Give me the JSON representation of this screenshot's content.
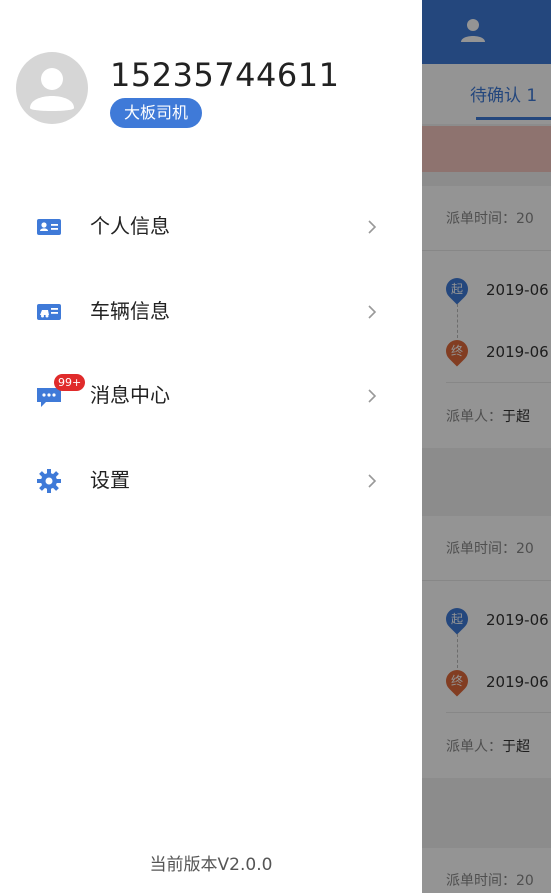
{
  "drawer": {
    "phone": "15235744611",
    "role": "大板司机",
    "menu": [
      {
        "label": "个人信息",
        "icon": "id-card-icon"
      },
      {
        "label": "车辆信息",
        "icon": "vehicle-card-icon"
      },
      {
        "label": "消息中心",
        "icon": "message-icon",
        "badge": "99+"
      },
      {
        "label": "设置",
        "icon": "gear-icon"
      }
    ],
    "version": "当前版本V2.0.0"
  },
  "background": {
    "tab_label": "待确认 1",
    "cards": [
      {
        "dispatch_time_label": "派单时间：20",
        "start_marker": "起",
        "start_date": "2019-06",
        "end_marker": "终",
        "end_date": "2019-06",
        "dispatcher_label": "派单人：",
        "dispatcher_name": "于超"
      },
      {
        "dispatch_time_label": "派单时间：20",
        "start_marker": "起",
        "start_date": "2019-06",
        "end_marker": "终",
        "end_date": "2019-06",
        "dispatcher_label": "派单人：",
        "dispatcher_name": "于超"
      }
    ],
    "third_card_time_label": "派单时间：20"
  },
  "colors": {
    "accent": "#3f7ad8",
    "end_marker": "#e06a3c",
    "badge": "#e02b2b"
  }
}
